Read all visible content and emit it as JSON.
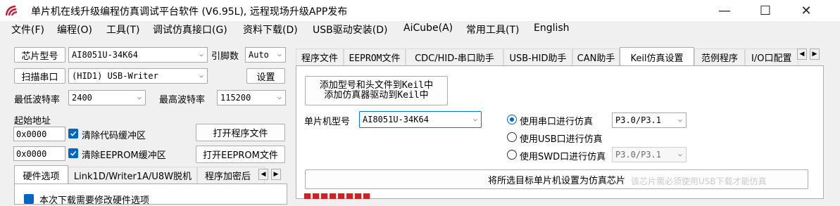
{
  "window": {
    "title": "单片机在线升级编程仿真调试平台软件 (V6.95L), 远程现场升级APP发布",
    "min_glyph": "—",
    "max_glyph": "☐",
    "close_glyph": "✕"
  },
  "menu": [
    "文件(F)",
    "编程(O)",
    "工具(T)",
    "调试仿真接口(G)",
    "资料下载(D)",
    "USB驱动安装(D)",
    "AiCube(A)",
    "常用工具(T)",
    "English"
  ],
  "left": {
    "chip_model_btn": "芯片型号",
    "chip_model_value": "AI8051U-34K64",
    "pin_count_label": "引脚数",
    "pin_count_value": "Auto",
    "scan_port_btn": "扫描串口",
    "port_value": "(HID1) USB-Writer",
    "settings_btn": "设置",
    "min_baud_label": "最低波特率",
    "min_baud_value": "2400",
    "max_baud_label": "最高波特率",
    "max_baud_value": "115200",
    "start_addr_label": "起始地址",
    "code_addr": "0x0000",
    "clear_code_label": "清除代码缓冲区",
    "open_prog_btn": "打开程序文件",
    "eeprom_addr": "0x0000",
    "clear_eeprom_label": "清除EEPROM缓冲区",
    "open_eeprom_btn": "打开EEPROM文件",
    "bottom_tabs": [
      "硬件选项",
      "Link1D/Writer1A/U8W脱机",
      "程序加密后"
    ],
    "partial_option": "本次下载需要修改硬件选项"
  },
  "right": {
    "tabs": [
      "程序文件",
      "EEPROM文件",
      "CDC/HID-串口助手",
      "USB-HID助手",
      "CAN助手",
      "Keil仿真设置",
      "范例程序",
      "I/O口配置"
    ],
    "add_model_btn_line1": "添加型号和头文件到Keil中",
    "add_model_btn_line2": "添加仿真器驱动到Keil中",
    "mcu_model_label": "单片机型号",
    "mcu_model_value": "AI8051U-34K64",
    "radio_serial": "使用串口进行仿真",
    "serial_port_value": "P3.0/P3.1",
    "radio_usb": "使用USB口进行仿真",
    "radio_swd": "使用SWD口进行仿真",
    "swd_port_value": "P3.0/P3.1",
    "set_target_btn": "将所选目标单片机设置为仿真芯片",
    "faded_hint": "该芯片需必须使用USB下载才能仿真"
  },
  "colors": {
    "accent": "#0067c0",
    "app_icon": "#c21f39",
    "red_text": "#d42020"
  }
}
